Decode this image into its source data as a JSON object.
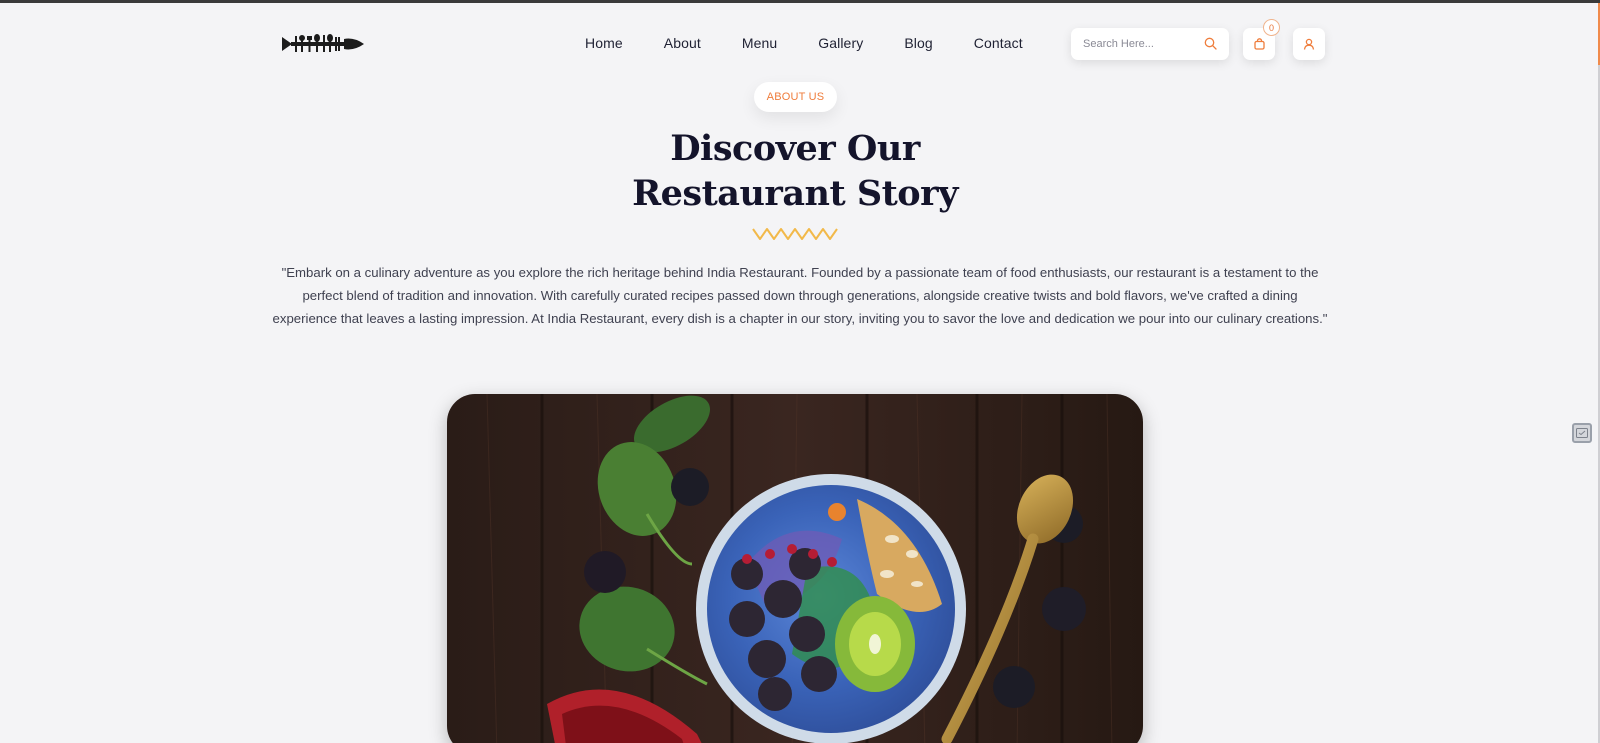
{
  "brand": {
    "logo_icon": "fish-cutlery-logo",
    "accent_color": "#ef7d3c",
    "heading_color": "#14142b",
    "zigzag_color": "#f2b94a"
  },
  "nav": {
    "items": [
      {
        "label": "Home"
      },
      {
        "label": "About"
      },
      {
        "label": "Menu"
      },
      {
        "label": "Gallery"
      },
      {
        "label": "Blog"
      },
      {
        "label": "Contact"
      }
    ]
  },
  "search": {
    "placeholder": "Search Here...",
    "value": "",
    "icon": "search-icon"
  },
  "cart": {
    "icon": "shopping-bag-icon",
    "count": "0"
  },
  "account": {
    "icon": "user-icon"
  },
  "about": {
    "tag": "ABOUT US",
    "title_line1": "Discover Our",
    "title_line2": "Restaurant Story",
    "story": "\"Embark on a culinary adventure as you explore the rich heritage behind India Restaurant. Founded by a passionate team of food enthusiasts, our restaurant is a testament to the perfect blend of tradition and innovation. With carefully curated recipes passed down through generations, alongside creative twists and bold flavors, we've crafted a dining experience that leaves a lasting impression. At India Restaurant, every dish is a chapter in our story, inviting you to savor the love and dedication we pour into our culinary creations.\""
  },
  "hero_image": {
    "subject": "smoothie bowl with berries, kiwi and granola on dark wood"
  }
}
